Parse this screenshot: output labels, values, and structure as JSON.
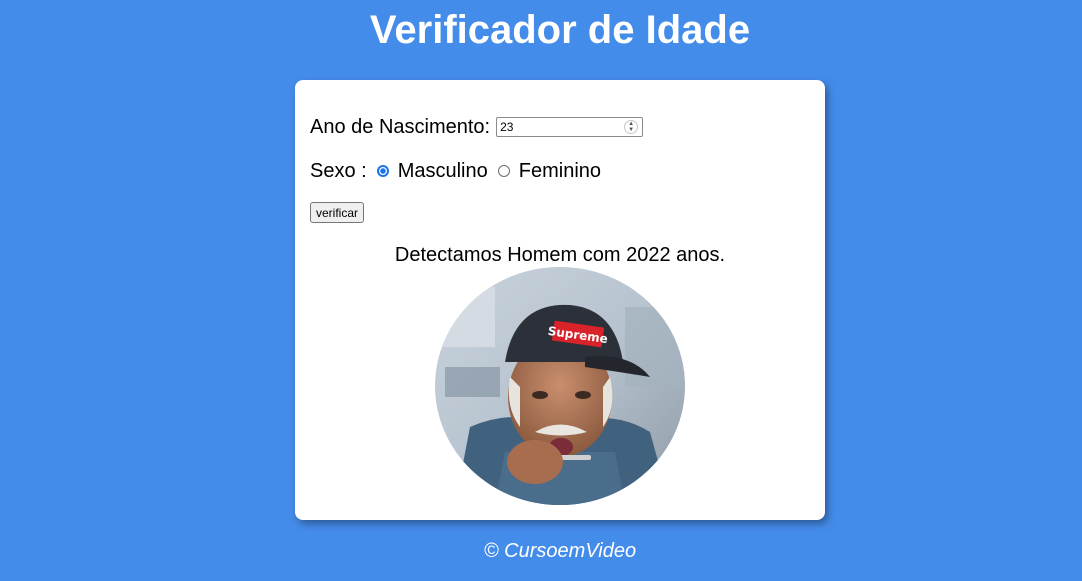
{
  "header": {
    "title": "Verificador de Idade"
  },
  "form": {
    "year_label": "Ano de Nascimento:",
    "year_value": "23",
    "sex_label": "Sexo :",
    "options": [
      {
        "label": "Masculino",
        "selected": true
      },
      {
        "label": "Feminino",
        "selected": false
      }
    ],
    "submit_label": "verificar"
  },
  "result": {
    "text": "Detectamos Homem com 2022 anos.",
    "image_icon": "elderly-man-photo",
    "image_text": "Supreme"
  },
  "footer": {
    "text": "© CursoemVideo"
  },
  "colors": {
    "background": "#448cea",
    "card": "#ffffff",
    "accent": "#1a73e8"
  }
}
